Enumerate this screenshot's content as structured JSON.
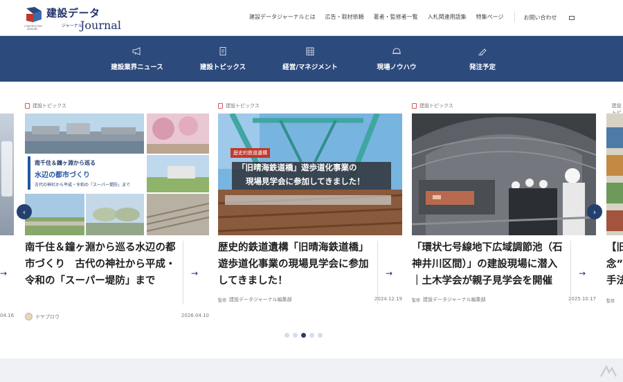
{
  "header": {
    "logo_jp": "建設データ",
    "logo_sub": "ジャーナル",
    "logo_en": "Journal",
    "topnav": [
      "建設データジャーナルとは",
      "広告・取材依頼",
      "著者・監修者一覧",
      "入札関連用語集",
      "特集ページ"
    ],
    "contact": "お問い合わせ"
  },
  "mainnav": [
    {
      "label": "建設業界ニュース",
      "icon": "megaphone-icon"
    },
    {
      "label": "建設トピックス",
      "icon": "document-icon"
    },
    {
      "label": "経営/マネジメント",
      "icon": "building-icon"
    },
    {
      "label": "現場ノウハウ",
      "icon": "helmet-icon"
    },
    {
      "label": "発注予定",
      "icon": "pen-icon"
    }
  ],
  "cards": [
    {
      "category": "建設トピックス",
      "thumb_lines": [
        "南千住＆鐘ヶ淵から巡る",
        "水辺の都市づくり",
        "古代の神社から平成・令和の「スーパー堤防」まで"
      ],
      "title": "南千住＆鐘ヶ淵から巡る水辺の都市づくり　古代の神社から平成・令和の「スーパー堤防」まで",
      "author": "テヤプロウ",
      "date": "2026.04.10"
    },
    {
      "category": "建設トピックス",
      "thumb_badge": "歴史的鉄道遺構",
      "thumb_lines": [
        "「旧晴海鉄道橋」遊歩道化事業の",
        "現場見学会に参加してきました！"
      ],
      "title": "歴史的鉄道遺構「旧晴海鉄道橋」遊歩道化事業の現場見学会に参加してきました！",
      "author": "建設データジャーナル編集部",
      "author_badge": "監修",
      "date": "2024.12.19"
    },
    {
      "category": "建設トピックス",
      "title": "「環状七号線地下広域調節池（石神井川区間）」の建設現場に潜入｜土木学会が親子見学会を開催",
      "author": "建設データジャーナル編集部",
      "author_badge": "監修",
      "date": "2025.10.17"
    },
    {
      "category": "建設トピックス",
      "title": "【旧",
      "title2": "念”",
      "title3": "手法",
      "author_badge": "監修"
    }
  ],
  "prev_card": {
    "date": "04.16"
  },
  "carousel": {
    "prev": "‹",
    "next": "›",
    "dots": 5,
    "active_dot": 2
  }
}
